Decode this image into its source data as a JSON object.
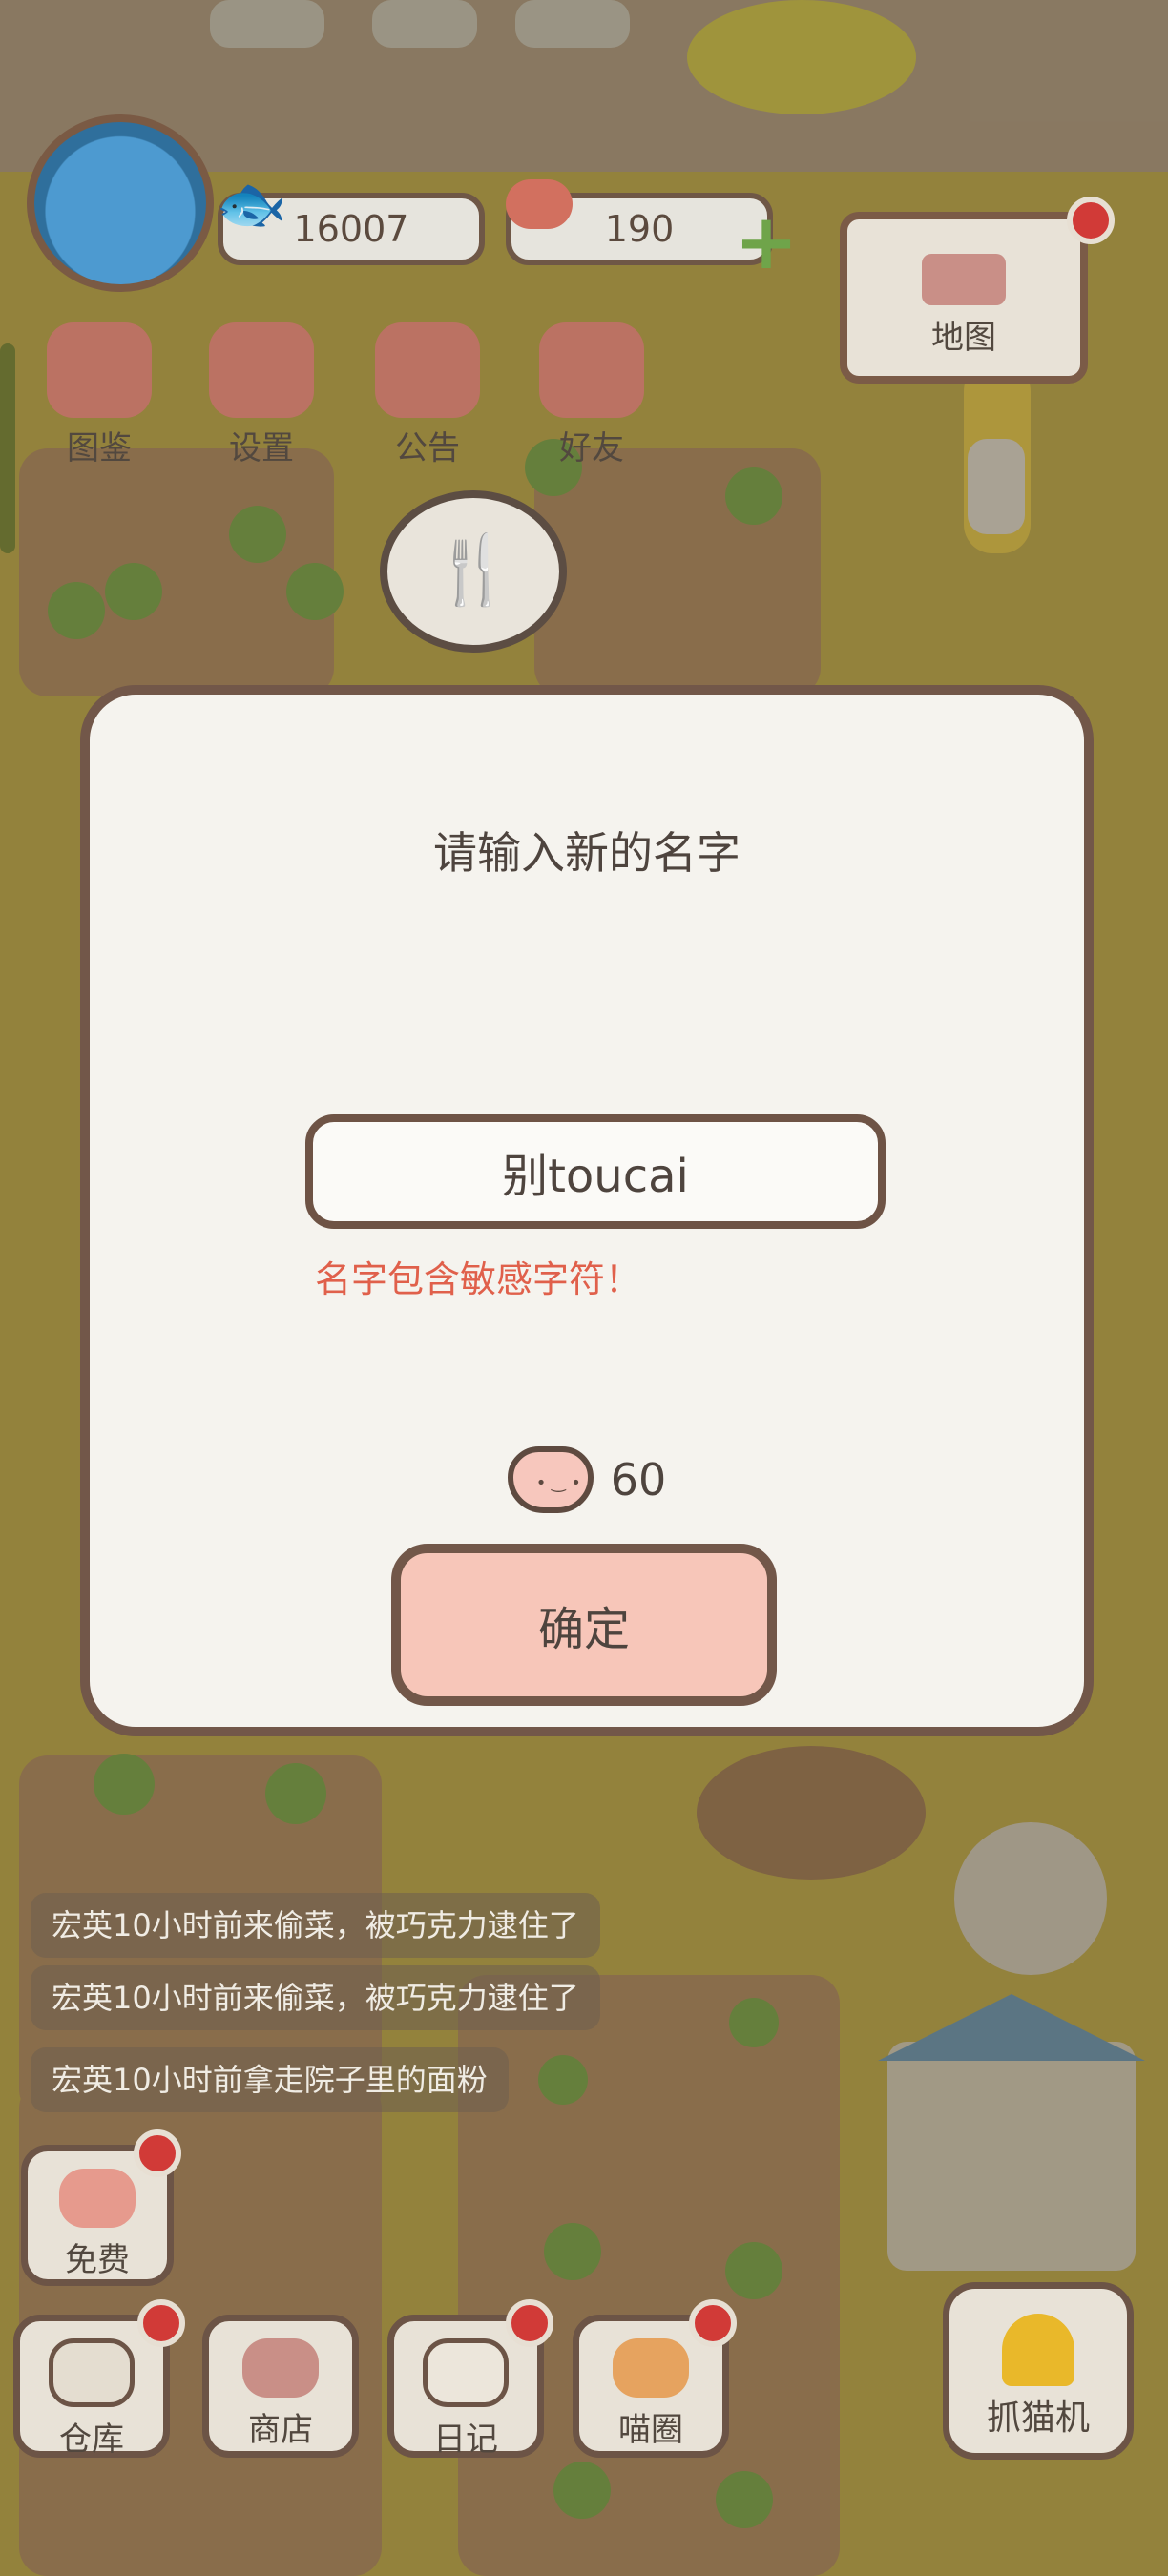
{
  "hud": {
    "fish_count": "16007",
    "heart_count": "190",
    "icons": [
      {
        "label": "图鉴",
        "icon": "cat-book-icon"
      },
      {
        "label": "设置",
        "icon": "gear-icon"
      },
      {
        "label": "公告",
        "icon": "gift-icon"
      },
      {
        "label": "好友",
        "icon": "friends-icon"
      }
    ],
    "map_label": "地图"
  },
  "dialog": {
    "title": "请输入新的名字",
    "name_value": "别toucai",
    "error": "名字包含敏感字符！",
    "cost": "60",
    "confirm_label": "确定"
  },
  "log": [
    "宏英10小时前来偷菜，被巧克力逮住了",
    "宏英10小时前来偷菜，被巧克力逮住了",
    "宏英10小时前拿走院子里的面粉"
  ],
  "bottom": {
    "free_label": "免费",
    "items": [
      {
        "label": "仓库",
        "icon": "warehouse-icon"
      },
      {
        "label": "商店",
        "icon": "shop-icon"
      },
      {
        "label": "日记",
        "icon": "diary-icon"
      },
      {
        "label": "喵圈",
        "icon": "cat-planet-icon"
      }
    ],
    "crane_label": "抓猫机"
  },
  "colors": {
    "modal_border": "#725749",
    "confirm_fill": "#f7c6b9",
    "error_red": "#e0604b",
    "notification_red": "#d13a37"
  }
}
